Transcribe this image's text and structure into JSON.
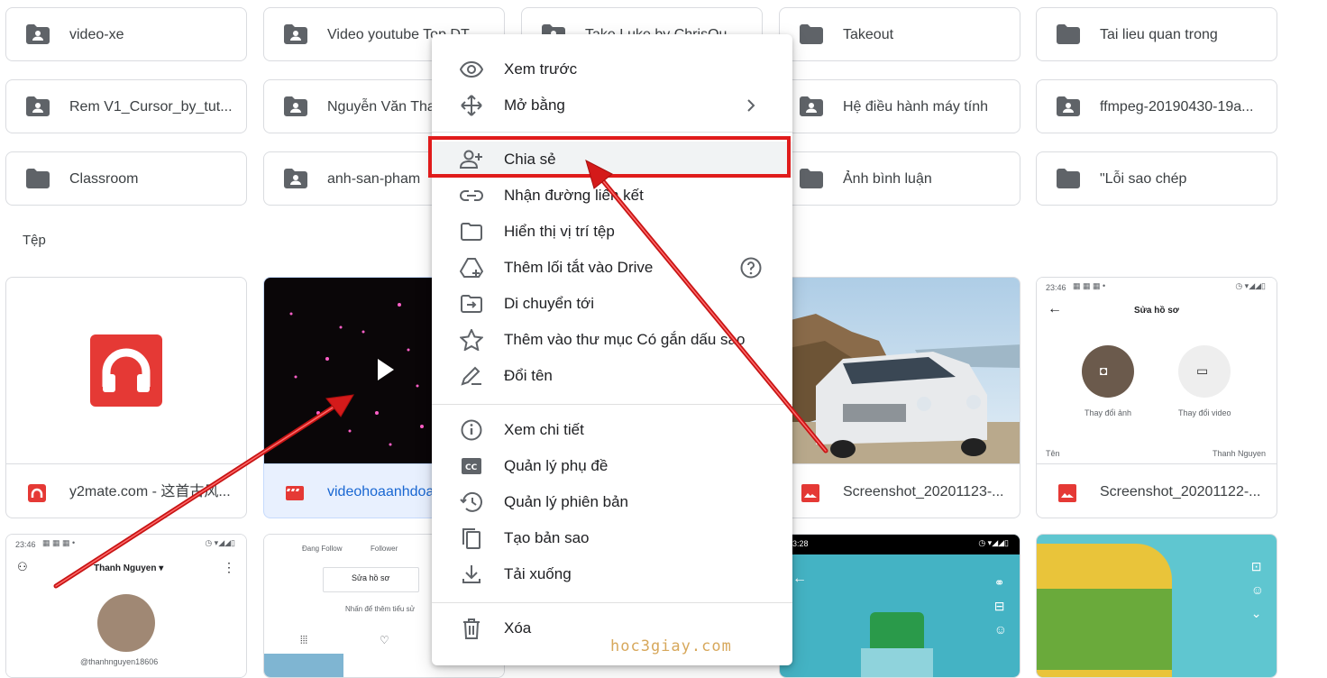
{
  "folders": [
    {
      "name": "video-xe",
      "icon": "shared-folder-icon"
    },
    {
      "name": "Video youtube Top DT",
      "icon": "shared-folder-icon"
    },
    {
      "name": "Take Luke by ChrisQu",
      "icon": "shared-folder-icon"
    },
    {
      "name": "Takeout",
      "icon": "folder-icon"
    },
    {
      "name": "Tai lieu quan trong",
      "icon": "folder-icon"
    },
    {
      "name": "Rem V1_Cursor_by_tut...",
      "icon": "shared-folder-icon"
    },
    {
      "name": "Nguyễn Văn Thanh",
      "icon": "shared-folder-icon"
    },
    {
      "name": "Hệ điều hành máy tính",
      "icon": "shared-folder-icon"
    },
    {
      "name": "ffmpeg-20190430-19a...",
      "icon": "shared-folder-icon"
    },
    {
      "name": "Classroom",
      "icon": "folder-icon"
    },
    {
      "name": "anh-san-pham",
      "icon": "shared-folder-icon"
    },
    {
      "name": "Ảnh bình luận",
      "icon": "folder-icon"
    },
    {
      "name": "\"Lỗi sao chép",
      "icon": "folder-icon"
    }
  ],
  "files_label": "Tệp",
  "files": [
    {
      "name": "y2mate.com - 这首古风...",
      "icon": "headphones-app-icon"
    },
    {
      "name": "videohoaanhdoan",
      "icon": "video-icon"
    },
    {
      "name": "Screenshot_20201123-...",
      "icon": "image-icon"
    },
    {
      "name": "Screenshot_20201122-...",
      "icon": "image-icon"
    }
  ],
  "phone1": {
    "time": "23:46",
    "title": "Sửa hồ sơ",
    "change_photo": "Thay đổi ảnh",
    "change_video": "Thay đổi video",
    "name_label": "Tên",
    "name_value": "Thanh Nguyen"
  },
  "phone2": {
    "time": "23:46",
    "user": "Thanh Nguyen ▾",
    "handle": "@thanhnguyen18606"
  },
  "phone3": {
    "following": "Đang Follow",
    "follower": "Follower",
    "edit": "Sửa hồ sơ",
    "bio_hint": "Nhấn để thêm tiểu sử"
  },
  "phone4": {
    "time": "3:28"
  },
  "menu": {
    "items": [
      {
        "label": "Xem trước",
        "icon": "eye-icon"
      },
      {
        "label": "Mở bằng",
        "icon": "move-arrows-icon"
      },
      {
        "label": "Chia sẻ",
        "icon": "add-person-icon"
      },
      {
        "label": "Nhận đường liên kết",
        "icon": "link-icon"
      },
      {
        "label": "Hiển thị vị trí tệp",
        "icon": "folder-outline-icon"
      },
      {
        "label": "Thêm lối tắt vào Drive",
        "icon": "drive-shortcut-icon"
      },
      {
        "label": "Di chuyển tới",
        "icon": "move-to-folder-icon"
      },
      {
        "label": "Thêm vào thư mục Có gắn dấu sao",
        "icon": "star-icon"
      },
      {
        "label": "Đổi tên",
        "icon": "pencil-icon"
      },
      {
        "label": "Xem chi tiết",
        "icon": "info-icon"
      },
      {
        "label": "Quản lý phụ đề",
        "icon": "captions-icon"
      },
      {
        "label": "Quản lý phiên bản",
        "icon": "history-icon"
      },
      {
        "label": "Tạo bản sao",
        "icon": "copy-icon"
      },
      {
        "label": "Tải xuống",
        "icon": "download-icon"
      },
      {
        "label": "Xóa",
        "icon": "trash-icon"
      }
    ]
  },
  "watermark": "hoc3giay.com",
  "colors": {
    "highlight": "#e01b1b",
    "arrow": "#e01b1b",
    "pdf_red": "#e53935",
    "drive_grey": "#5f6368"
  }
}
